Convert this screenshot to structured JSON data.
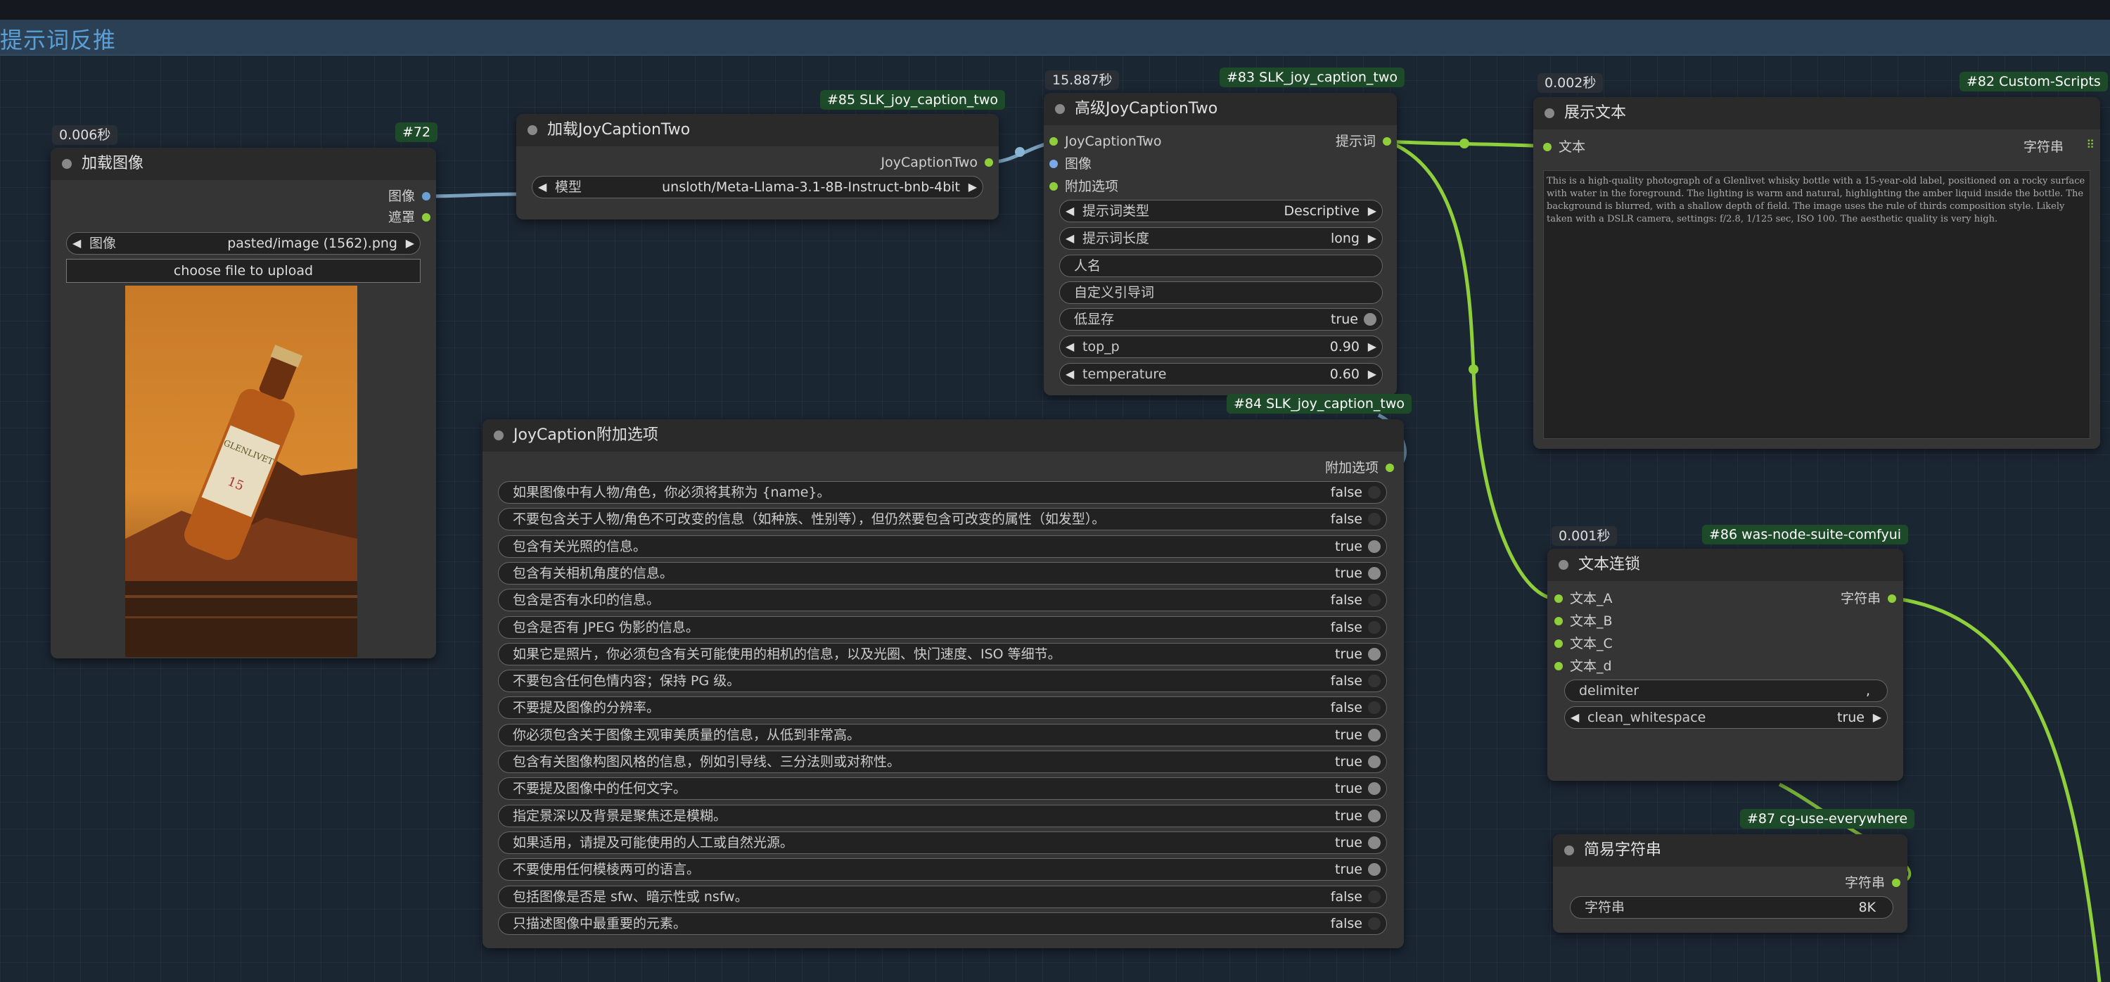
{
  "group": {
    "title": "提示词反推"
  },
  "nodes": {
    "load_image": {
      "id_badge": "#72",
      "time_badge": "0.006秒",
      "title": "加载图像",
      "outputs": [
        "图像",
        "遮罩"
      ],
      "image_widget": {
        "label": "图像",
        "value": "pasted/image (1562).png"
      },
      "upload_button": "choose file to upload",
      "preview_desc": "whisky bottle photo"
    },
    "load_joy": {
      "id_badge": "#85 SLK_joy_caption_two",
      "title": "加载JoyCaptionTwo",
      "output": "JoyCaptionTwo",
      "model_widget": {
        "label": "模型",
        "value": "unsloth/Meta-Llama-3.1-8B-Instruct-bnb-4bit"
      }
    },
    "adv_joy": {
      "id_badge": "#83 SLK_joy_caption_two",
      "time_badge": "15.887秒",
      "title": "高级JoyCaptionTwo",
      "inputs": [
        "JoyCaptionTwo",
        "图像",
        "附加选项"
      ],
      "output": "提示词",
      "widgets": [
        {
          "label": "提示词类型",
          "value": "Descriptive",
          "kind": "combo"
        },
        {
          "label": "提示词长度",
          "value": "long",
          "kind": "combo"
        },
        {
          "label": "人名",
          "value": "",
          "kind": "text"
        },
        {
          "label": "自定义引导词",
          "value": "",
          "kind": "text"
        },
        {
          "label": "低显存",
          "value": "true",
          "kind": "bool"
        },
        {
          "label": "top_p",
          "value": "0.90",
          "kind": "combo"
        },
        {
          "label": "temperature",
          "value": "0.60",
          "kind": "combo"
        }
      ]
    },
    "show_text": {
      "id_badge": "#82 Custom-Scripts",
      "time_badge": "0.002秒",
      "title": "展示文本",
      "input": "文本",
      "output": "字符串",
      "text": "This is a high-quality photograph of a Glenlivet whisky bottle with a 15-year-old label, positioned on a rocky surface with water in the foreground. The lighting is warm and natural, highlighting the amber liquid inside the bottle. The background is blurred, with a shallow depth of field. The image uses the rule of thirds composition style. Likely taken with a DSLR camera, settings: f/2.8, 1/125 sec, ISO 100. The aesthetic quality is very high."
    },
    "extra_opts": {
      "id_badge": "#84 SLK_joy_caption_two",
      "title": "JoyCaption附加选项",
      "output": "附加选项",
      "options": [
        {
          "label": "如果图像中有人物/角色，你必须将其称为 {name}。",
          "value": "false"
        },
        {
          "label": "不要包含关于人物/角色不可改变的信息（如种族、性别等），但仍然要包含可改变的属性（如发型）。",
          "value": "false"
        },
        {
          "label": "包含有关光照的信息。",
          "value": "true"
        },
        {
          "label": "包含有关相机角度的信息。",
          "value": "true"
        },
        {
          "label": "包含是否有水印的信息。",
          "value": "false"
        },
        {
          "label": "包含是否有 JPEG 伪影的信息。",
          "value": "false"
        },
        {
          "label": "如果它是照片，你必须包含有关可能使用的相机的信息，以及光圈、快门速度、ISO 等细节。",
          "value": "true"
        },
        {
          "label": "不要包含任何色情内容；保持 PG 级。",
          "value": "false"
        },
        {
          "label": "不要提及图像的分辨率。",
          "value": "false"
        },
        {
          "label": "你必须包含关于图像主观审美质量的信息，从低到非常高。",
          "value": "true"
        },
        {
          "label": "包含有关图像构图风格的信息，例如引导线、三分法则或对称性。",
          "value": "true"
        },
        {
          "label": "不要提及图像中的任何文字。",
          "value": "true"
        },
        {
          "label": "指定景深以及背景是聚焦还是模糊。",
          "value": "true"
        },
        {
          "label": "如果适用，请提及可能使用的人工或自然光源。",
          "value": "true"
        },
        {
          "label": "不要使用任何模棱两可的语言。",
          "value": "true"
        },
        {
          "label": "包括图像是否是 sfw、暗示性或 nsfw。",
          "value": "false"
        },
        {
          "label": "只描述图像中最重要的元素。",
          "value": "false"
        }
      ]
    },
    "concat": {
      "id_badge": "#86 was-node-suite-comfyui",
      "time_badge": "0.001秒",
      "title": "文本连锁",
      "inputs": [
        "文本_A",
        "文本_B",
        "文本_C",
        "文本_d"
      ],
      "output": "字符串",
      "delimiter": {
        "label": "delimiter",
        "value": ","
      },
      "clean": {
        "label": "clean_whitespace",
        "value": "true"
      }
    },
    "simple_str": {
      "id_badge": "#87 cg-use-everywhere",
      "title": "简易字符串",
      "output": "字符串",
      "widget": {
        "label": "字符串",
        "value": "8K"
      }
    }
  },
  "colors": {
    "wire_green": "#8ecf3b",
    "wire_blue": "#8ab6d6",
    "badge_green": "#1d4a28",
    "group_blue": "#5aa0d6"
  }
}
